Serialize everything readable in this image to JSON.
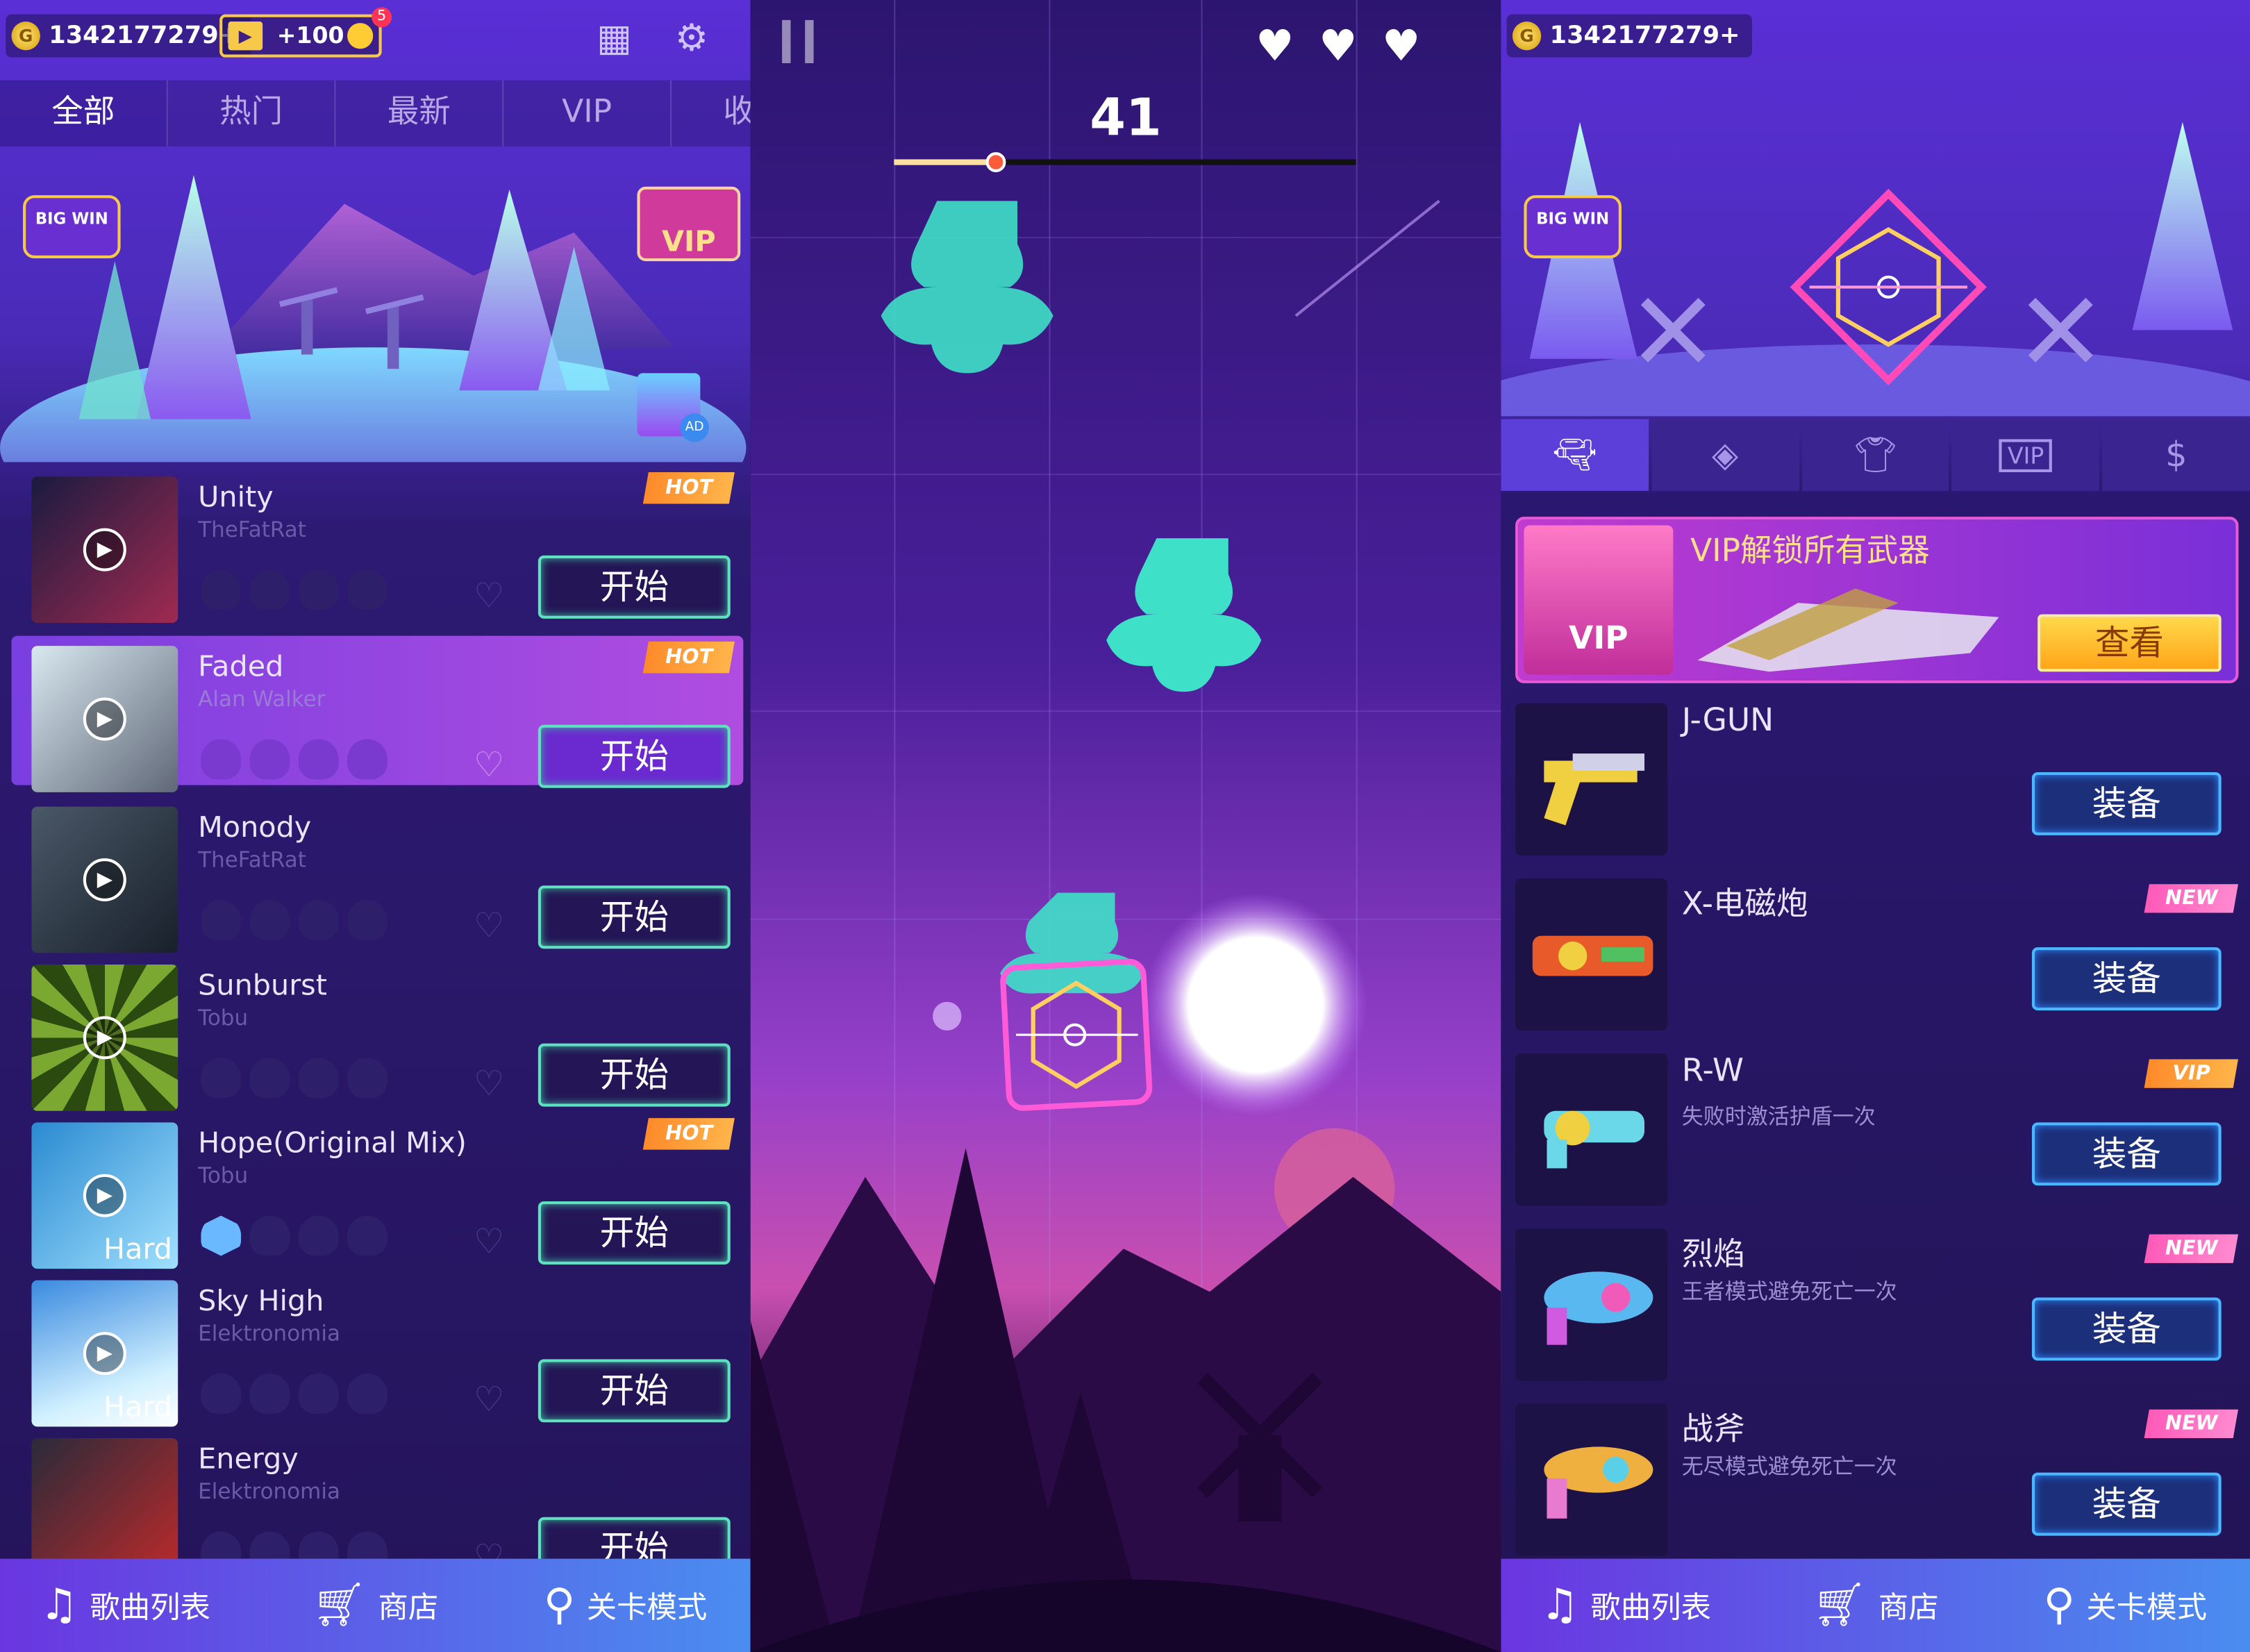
{
  "list": {
    "coins": "1342177279",
    "ad_reward": "+100",
    "ad_badge": "5",
    "tabs": [
      "全部",
      "热门",
      "最新",
      "VIP",
      "收"
    ],
    "banner_big_win": "BIG WIN",
    "banner_vip": "VIP",
    "banner_ad": "AD",
    "songs": [
      {
        "title": "Unity",
        "artist": "TheFatRat",
        "tag": "HOT",
        "button": "开始",
        "hard": ""
      },
      {
        "title": "Faded",
        "artist": "Alan Walker",
        "tag": "HOT",
        "button": "开始",
        "hard": ""
      },
      {
        "title": "Monody",
        "artist": "TheFatRat",
        "tag": "",
        "button": "开始",
        "hard": ""
      },
      {
        "title": "Sunburst",
        "artist": "Tobu",
        "tag": "",
        "button": "开始",
        "hard": ""
      },
      {
        "title": "Hope(Original Mix)",
        "artist": "Tobu",
        "tag": "HOT",
        "button": "开始",
        "hard": "Hard"
      },
      {
        "title": "Sky High",
        "artist": "Elektronomia",
        "tag": "",
        "button": "开始",
        "hard": "Hard"
      },
      {
        "title": "Energy",
        "artist": "Elektronomia",
        "tag": "",
        "button": "开始",
        "hard": ""
      }
    ],
    "nav": [
      "歌曲列表",
      "商店",
      "关卡模式"
    ]
  },
  "game": {
    "score": "41",
    "lives": 3,
    "progress": 0.22
  },
  "shop": {
    "coins": "1342177279",
    "banner_big_win": "BIG WIN",
    "tab_icons": [
      "gun-icon",
      "target-icon",
      "shirt-icon",
      "vip-icon",
      "dollar-icon"
    ],
    "tab_vip_label": "VIP",
    "vip_banner": {
      "title": "VIP解锁所有武器",
      "button": "查看",
      "badge": "VIP"
    },
    "weapons": [
      {
        "name": "J-GUN",
        "desc": "",
        "tag": "",
        "button": "装备"
      },
      {
        "name": "X-电磁炮",
        "desc": "",
        "tag": "NEW",
        "button": "装备"
      },
      {
        "name": "R-W",
        "desc": "失败时激活护盾一次",
        "tag": "VIP",
        "button": "装备"
      },
      {
        "name": "烈焰",
        "desc": "王者模式避免死亡一次",
        "tag": "NEW",
        "button": "装备"
      },
      {
        "name": "战斧",
        "desc": "无尽模式避免死亡一次",
        "tag": "NEW",
        "button": "装备"
      }
    ],
    "nav": [
      "歌曲列表",
      "商店",
      "关卡模式"
    ]
  },
  "colors": {
    "accent_green": "#5fe0c0",
    "accent_blue": "#4ab7ff",
    "hot": "#ff8a2a",
    "new": "#ff5ab8",
    "note": "#3fe0c8"
  }
}
